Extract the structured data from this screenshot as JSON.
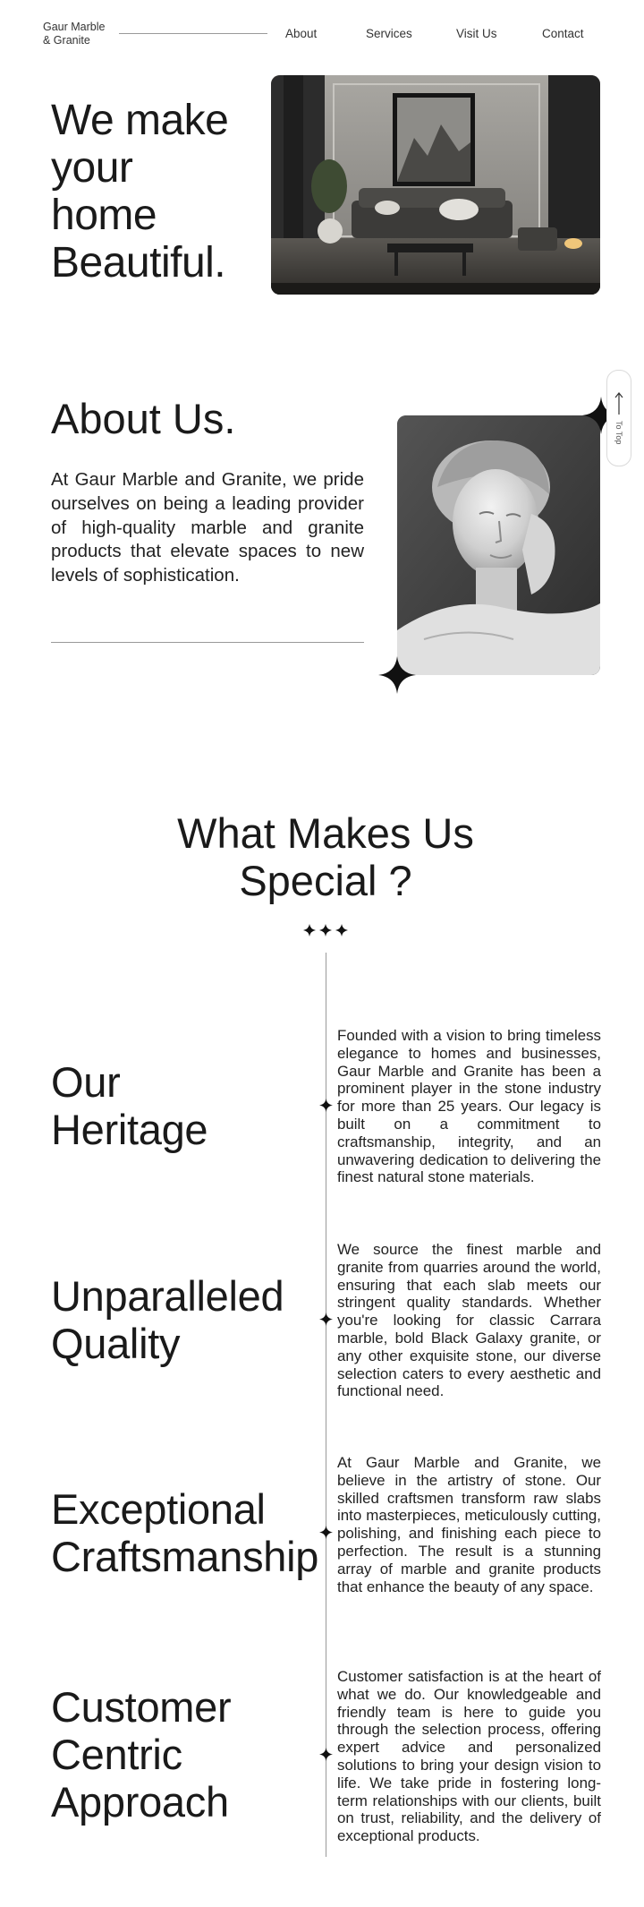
{
  "nav": {
    "logo_line1": "Gaur Marble",
    "logo_line2": "& Granite",
    "links": [
      "About",
      "Services",
      "Visit Us",
      "Contact"
    ]
  },
  "hero": {
    "title_lines": [
      "We make",
      "your",
      "home",
      "Beautiful."
    ]
  },
  "about": {
    "title": "About Us.",
    "text": "At Gaur Marble and Granite, we pride ourselves on being a leading provider of high-quality marble and granite products that elevate spaces to new levels of sophistication."
  },
  "to_top": {
    "label": "To Top"
  },
  "special": {
    "title_line1": "What Makes Us",
    "title_line2": "Special ?"
  },
  "sections": [
    {
      "title_lines": [
        "Our",
        "Heritage"
      ],
      "text": "Founded with a vision to bring timeless elegance to homes and businesses, Gaur Marble and Granite has been a prominent player in the stone industry for more than 25 years. Our legacy is built on a commitment to craftsmanship, integrity, and an unwavering dedication to delivering the finest natural stone materials."
    },
    {
      "title_lines": [
        "Unparalleled",
        "Quality"
      ],
      "text": "We source the finest marble and granite from quarries around the world, ensuring that each slab meets our stringent quality standards. Whether you're looking for classic Carrara marble, bold Black Galaxy granite, or any other exquisite stone, our diverse selection caters to every aesthetic and functional need."
    },
    {
      "title_lines": [
        "Exceptional",
        "Craftsmanship"
      ],
      "text": "At Gaur Marble and Granite, we believe in the artistry of stone. Our skilled craftsmen transform raw slabs into masterpieces, meticulously cutting, polishing, and finishing each piece to perfection. The result is a stunning array of marble and granite products that enhance the beauty of any space."
    },
    {
      "title_lines": [
        "Customer",
        "Centric",
        "Approach"
      ],
      "text": "Customer satisfaction is at the heart of what we do. Our knowledgeable and friendly team is here to guide you through the selection process, offering expert advice and personalized solutions to bring your design vision to life. We take pride in fostering long-term relationships with our clients, built on trust, reliability, and the delivery of exceptional products."
    }
  ]
}
